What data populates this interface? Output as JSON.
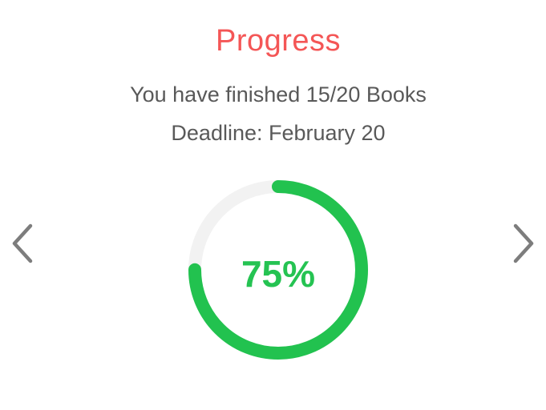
{
  "progress": {
    "title": "Progress",
    "finished_text": "You have finished 15/20 Books",
    "deadline_text": "Deadline: February 20",
    "percent_label": "75%",
    "fraction": 0.75
  },
  "colors": {
    "title": "#f45656",
    "text": "#595959",
    "ring_fill": "#22c24f",
    "ring_track": "#f2f2f2",
    "percent": "#25c352",
    "nav": "#7d7d7d"
  },
  "icons": {
    "prev": "chevron-left-icon",
    "next": "chevron-right-icon"
  }
}
